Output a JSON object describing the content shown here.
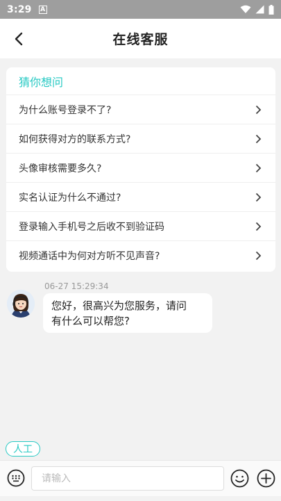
{
  "status_bar": {
    "time": "3:29",
    "notification_badge": "A"
  },
  "header": {
    "title": "在线客服"
  },
  "faq": {
    "heading": "猜你想问",
    "items": [
      {
        "label": "为什么账号登录不了?"
      },
      {
        "label": "如何获得对方的联系方式?"
      },
      {
        "label": "头像审核需要多久?"
      },
      {
        "label": "实名认证为什么不通过?"
      },
      {
        "label": "登录输入手机号之后收不到验证码"
      },
      {
        "label": "视频通话中为何对方听不见声音?"
      }
    ]
  },
  "chat": {
    "timestamp": "06-27 15:29:34",
    "messages": [
      {
        "text_line1": "您好，很高兴为您服务，请问",
        "text_line2": "有什么可以帮您?"
      }
    ]
  },
  "quick_action": {
    "label": "人工"
  },
  "composer": {
    "placeholder": "请输入"
  },
  "colors": {
    "accent": "#26c9c3",
    "background": "#f2f2f2",
    "statusbar": "#9e9e9e"
  }
}
